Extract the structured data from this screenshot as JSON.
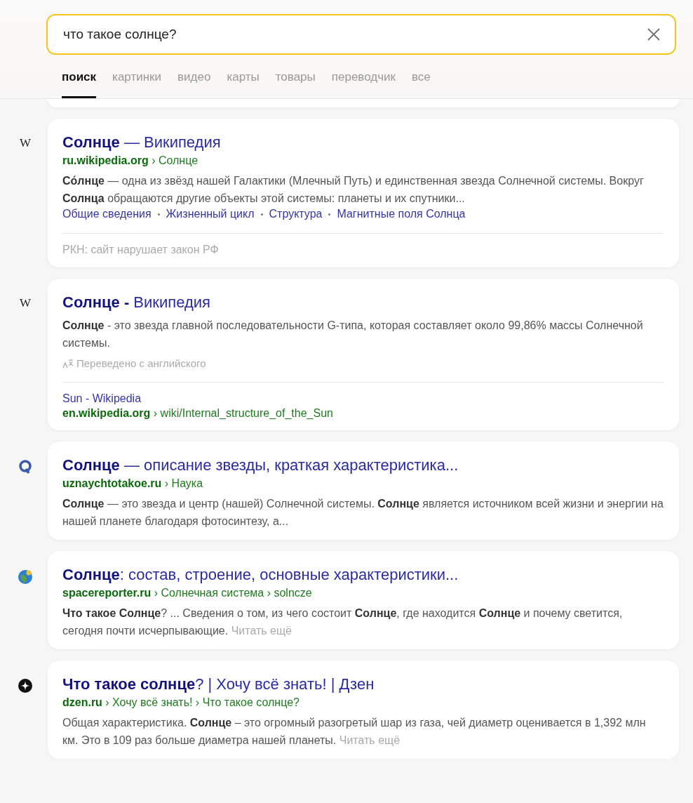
{
  "search": {
    "value": "что такое солнце?"
  },
  "tabs": [
    {
      "label": "поиск",
      "selected": true
    },
    {
      "label": "картинки",
      "selected": false
    },
    {
      "label": "видео",
      "selected": false
    },
    {
      "label": "карты",
      "selected": false
    },
    {
      "label": "товары",
      "selected": false
    },
    {
      "label": "переводчик",
      "selected": false
    },
    {
      "label": "все",
      "selected": false
    }
  ],
  "results": [
    {
      "favicon": {
        "kind": "letter",
        "letter": "W"
      },
      "title": "**Солнце** — Википедия",
      "url": "**ru.wikipedia.org** › Солнце",
      "snippet": "**Со́лнце** — одна из звёзд нашей Галактики (Млечный Путь) и единственная звезда Солнечной системы. Вокруг **Солнца** обращаются другие объекты этой системы: планеты и их спутники...",
      "sitelinks": [
        "Общие сведения",
        "Жизненный цикл",
        "Структура",
        "Магнитные поля Солнца"
      ],
      "notice": "РКН: сайт нарушает закон РФ"
    },
    {
      "favicon": {
        "kind": "letter",
        "letter": "W"
      },
      "title": "**Солнце -** Википедия",
      "snippet": "**Солнце** - это звезда главной последовательности G-типа, которая составляет около 99,86% массы Солнечной системы.",
      "translated": "Переведено с английского",
      "source": {
        "title": "Sun - Wikipedia",
        "url": "**en.wikipedia.org** › wiki/Internal_structure_of_the_Sun"
      }
    },
    {
      "favicon": {
        "kind": "q"
      },
      "title": "**Солнце** — описание звезды, краткая характеристика...",
      "url": "**uznaychtotakoe.ru** › Наука",
      "snippet": "**Солнце** — это звезда и центр (нашей) Солнечной системы. **Солнце** является источником всей жизни и энергии на нашей планете благодаря фотосинтезу, а..."
    },
    {
      "favicon": {
        "kind": "globe"
      },
      "title": "**Солнце**: состав, строение, основные характеристики...",
      "url": "**spacereporter.ru** › Солнечная система › solncze",
      "snippet": "**Что такое Солнце**? ... Сведения о том, из чего состоит **Солнце**, где находится **Солнце** и почему светится, сегодня почти исчерпывающие.",
      "read_more": "Читать ещё"
    },
    {
      "favicon": {
        "kind": "dzen"
      },
      "title": "**Что такое солнце**? | Хочу всё знать! | Дзен",
      "url": "**dzen.ru** › Хочу всё знать! › Что такое солнце?",
      "snippet": "Общая характеристика. **Солнце** – это огромный разогретый шар из газа, чей диаметр оценивается в 1,392 млн км. Это в 109 раз больше диаметра нашей планеты.",
      "read_more": "Читать ещё"
    }
  ]
}
